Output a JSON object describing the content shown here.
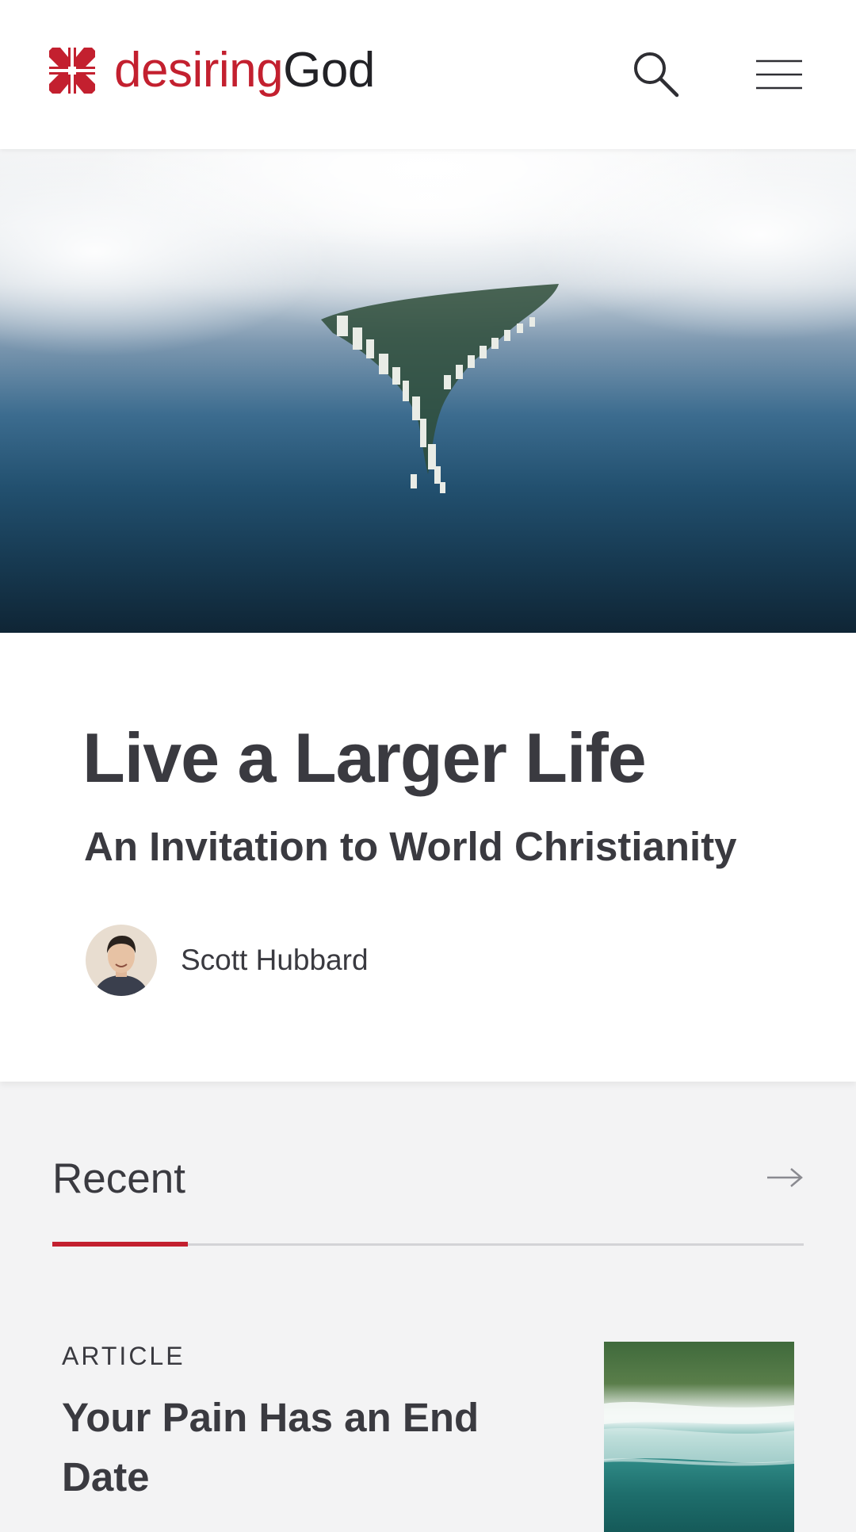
{
  "header": {
    "logo_desiring": "desiring",
    "logo_god": "God",
    "brand_color": "#c3202f",
    "search_icon": "search-icon",
    "menu_icon": "hamburger-menu-icon"
  },
  "feature": {
    "title": "Live a Larger Life",
    "subtitle": "An Invitation to World Christianity",
    "author": "Scott Hubbard"
  },
  "recent": {
    "heading": "Recent",
    "arrow_icon": "arrow-right-icon",
    "items": [
      {
        "type": "ARTICLE",
        "title": "Your Pain Has an End Date"
      }
    ]
  }
}
